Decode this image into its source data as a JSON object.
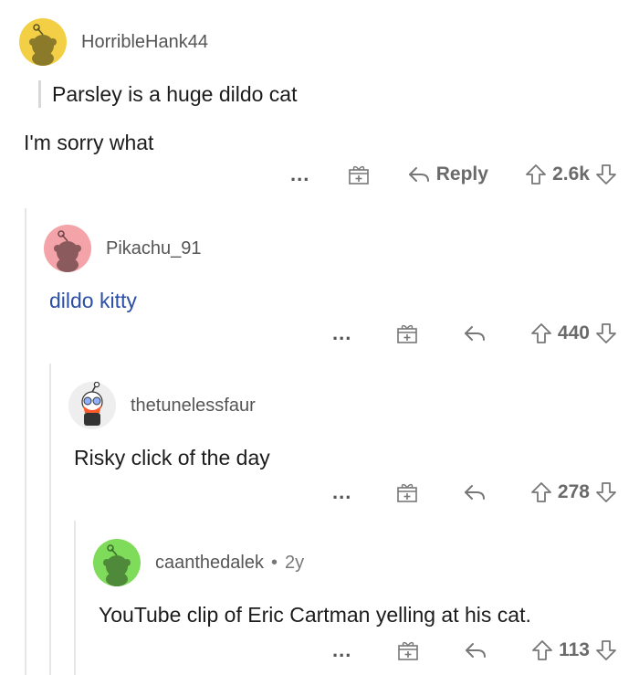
{
  "comments": [
    {
      "username": "HorribleHank44",
      "avatar_color": "#f3cf45",
      "quote": "Parsley is a huge dildo cat",
      "text": "I'm sorry what",
      "more": "...",
      "reply_label": "Reply",
      "votes": "2.6k"
    },
    {
      "username": "Pikachu_91",
      "avatar_color": "#f4a3a8",
      "text": "dildo kitty",
      "more": "...",
      "votes": "440"
    },
    {
      "username": "thetunelessfaur",
      "avatar_color": "#eeeeee",
      "text": "Risky click of the day",
      "more": "...",
      "votes": "278"
    },
    {
      "username": "caanthedalek",
      "avatar_color": "#7fdc5a",
      "separator": "•",
      "age": "2y",
      "text": "YouTube clip of Eric Cartman yelling at his cat.",
      "more": "...",
      "votes": "113"
    }
  ],
  "icons": {
    "more": "more-options-icon",
    "award": "gift-award-icon",
    "reply": "reply-arrow-icon",
    "upvote": "upvote-arrow-icon",
    "downvote": "downvote-arrow-icon"
  }
}
